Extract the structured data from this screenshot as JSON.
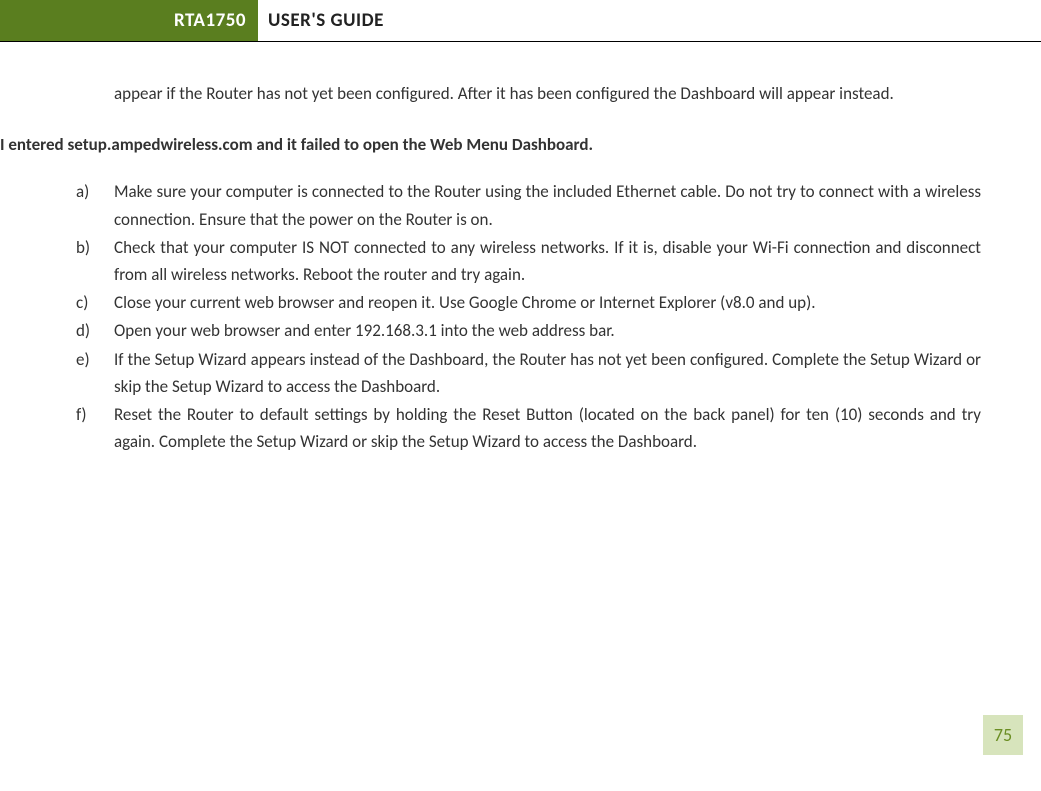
{
  "header": {
    "product": "RTA1750",
    "title": "USER'S GUIDE"
  },
  "intro": "appear if the Router has not yet been configured.  After it has been configured the Dashboard will appear instead.",
  "section_heading": "I entered setup.ampedwireless.com and it failed to open the Web Menu Dashboard.",
  "items": [
    {
      "marker": "a)",
      "text": "Make sure your computer is connected to the Router using the included Ethernet cable. Do not try to connect with a wireless connection. Ensure that the power on the Router is on."
    },
    {
      "marker": "b)",
      "text": "Check that your computer IS NOT connected to any wireless networks. If it is, disable your Wi-Fi connection and disconnect from all wireless networks. Reboot the router and try again."
    },
    {
      "marker": "c)",
      "text": "Close your current web browser and reopen it.  Use Google Chrome or Internet Explorer (v8.0 and up)."
    },
    {
      "marker": "d)",
      "text": "Open your web browser and enter 192.168.3.1 into the web address bar."
    },
    {
      "marker": "e)",
      "text": "If the Setup Wizard appears instead of the Dashboard, the Router has not yet been configured. Complete the Setup Wizard or skip the Setup Wizard to access the Dashboard."
    },
    {
      "marker": "f)",
      "text": "Reset the Router to default settings by holding the Reset Button (located on the back panel) for ten (10) seconds and try again.  Complete the Setup Wizard or skip the Setup Wizard to access the Dashboard."
    }
  ],
  "page_number": "75"
}
